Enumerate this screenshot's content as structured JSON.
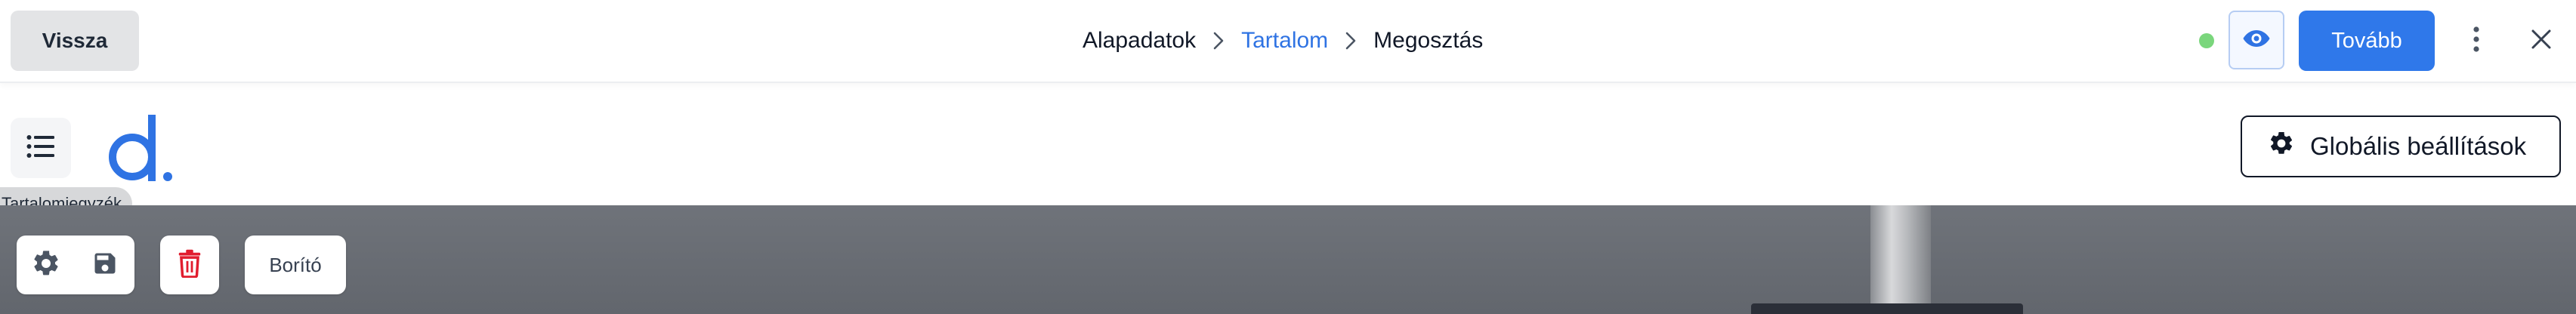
{
  "header": {
    "back_label": "Vissza",
    "breadcrumb": [
      "Alapadatok",
      "Tartalom",
      "Megosztás"
    ],
    "active_crumb": "Tartalom",
    "next_label": "Tovább"
  },
  "toolbar": {
    "global_settings_label": "Globális beállítások",
    "toc_tooltip": "Tartalomjegyzék"
  },
  "block_tools": {
    "cover_label": "Borító"
  },
  "icons": {
    "preview": "eye-icon",
    "more": "more-vertical-icon",
    "close": "close-icon",
    "toc": "list-icon",
    "settings": "gear-icon",
    "save": "save-icon",
    "delete": "trash-icon"
  },
  "colors": {
    "accent": "#2f78ea",
    "active_crumb": "#2f73e3",
    "status": "#7ad67c",
    "delete": "#e11d2e",
    "logo": "#2f73e3"
  }
}
